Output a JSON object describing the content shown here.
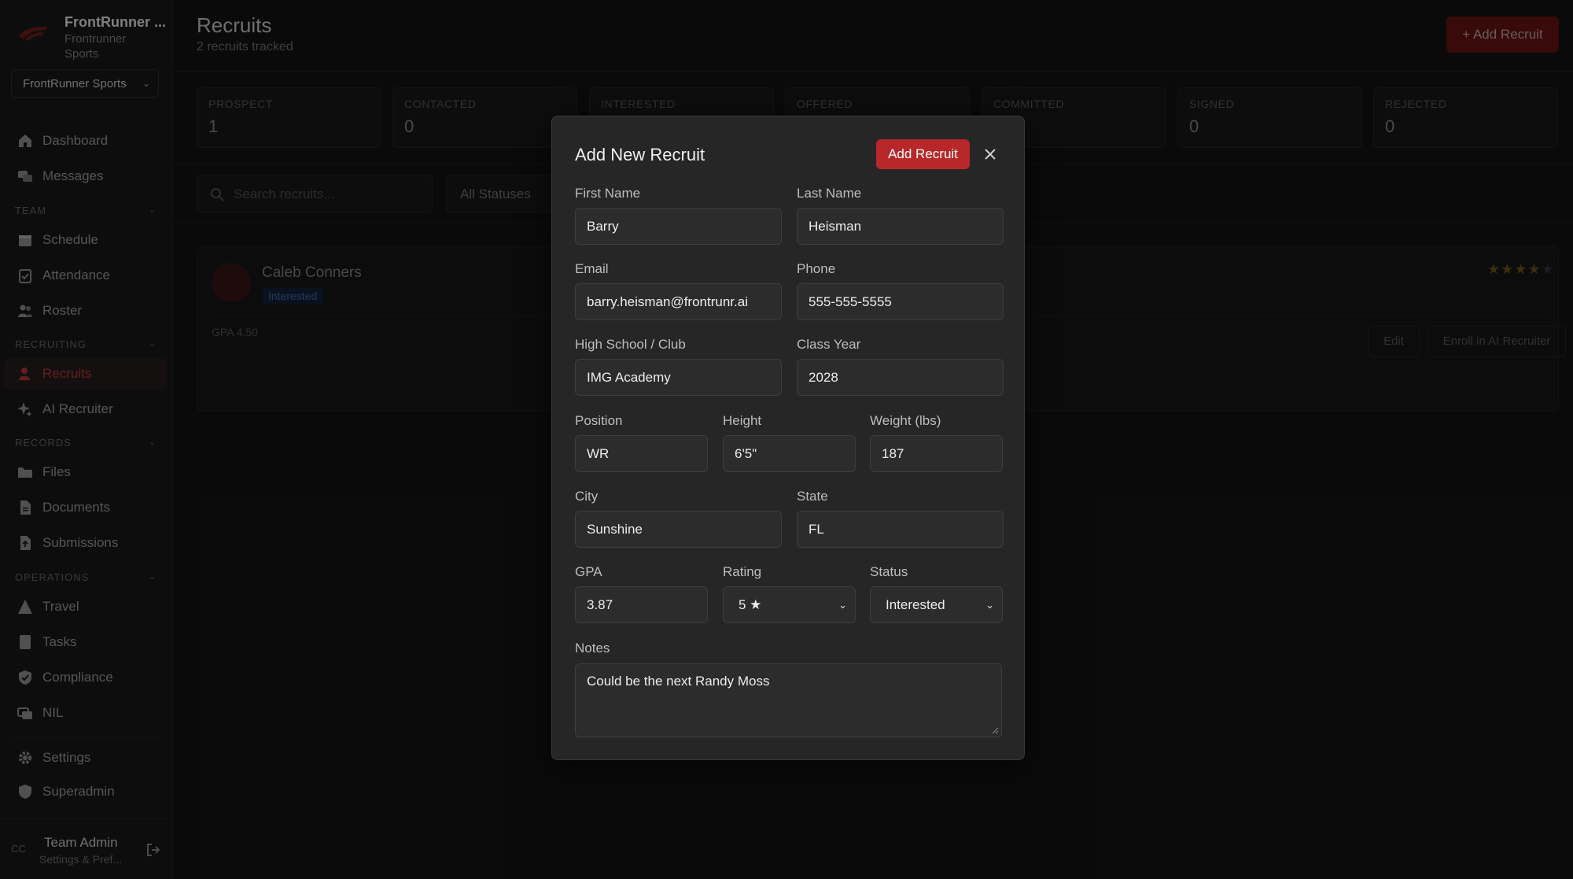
{
  "brand": {
    "name": "FrontRunner ...",
    "sub": "Frontrunner Sports"
  },
  "org_select": {
    "value": "FrontRunner Sports"
  },
  "nav": {
    "dashboard": "Dashboard",
    "messages": "Messages",
    "team_hdr": "TEAM",
    "schedule": "Schedule",
    "attendance": "Attendance",
    "roster": "Roster",
    "recruiting_hdr": "RECRUITING",
    "recruits": "Recruits",
    "ai_recruiter": "AI Recruiter",
    "records_hdr": "RECORDS",
    "files": "Files",
    "documents": "Documents",
    "submissions": "Submissions",
    "operations_hdr": "OPERATIONS",
    "travel": "Travel",
    "tasks": "Tasks",
    "compliance": "Compliance",
    "nil": "NIL",
    "settings": "Settings",
    "superadmin": "Superadmin"
  },
  "user": {
    "initials": "CC",
    "name": "Team Admin",
    "sub": "Settings & Pref..."
  },
  "page": {
    "title": "Recruits",
    "subtitle": "2 recruits tracked",
    "add_button": "+ Add Recruit"
  },
  "stats": [
    {
      "label": "PROSPECT",
      "value": "1"
    },
    {
      "label": "CONTACTED",
      "value": "0"
    },
    {
      "label": "INTERESTED",
      "value": ""
    },
    {
      "label": "OFFERED",
      "value": ""
    },
    {
      "label": "COMMITTED",
      "value": ""
    },
    {
      "label": "SIGNED",
      "value": "0"
    },
    {
      "label": "REJECTED",
      "value": "0"
    }
  ],
  "filters": {
    "search_placeholder": "Search recruits...",
    "status": "All Statuses"
  },
  "card": {
    "name": "Caleb Conners",
    "badge": "Interested",
    "gpa": "GPA 4.50",
    "stars_on": "★★★★",
    "stars_off": "★",
    "rating": 4,
    "edit": "Edit",
    "enroll": "Enroll in AI Recruiter"
  },
  "modal": {
    "title": "Add New Recruit",
    "submit": "Add Recruit",
    "labels": {
      "first_name": "First Name",
      "last_name": "Last Name",
      "email": "Email",
      "phone": "Phone",
      "school": "High School / Club",
      "class_year": "Class Year",
      "position": "Position",
      "height": "Height",
      "weight": "Weight (lbs)",
      "city": "City",
      "state": "State",
      "gpa": "GPA",
      "rating": "Rating",
      "status": "Status",
      "notes": "Notes"
    },
    "values": {
      "first_name": "Barry",
      "last_name": "Heisman",
      "email": "barry.heisman@frontrunr.ai",
      "phone": "555-555-5555",
      "school": "IMG Academy",
      "class_year": "2028",
      "position": "WR",
      "height": "6'5\"",
      "weight": "187",
      "city": "Sunshine",
      "state": "FL",
      "gpa": "3.87",
      "rating": "5 ★",
      "status": "Interested",
      "notes": "Could be the next Randy Moss"
    }
  },
  "colors": {
    "accent": "#b8282a",
    "background": "#151515",
    "modal": "#262626"
  }
}
